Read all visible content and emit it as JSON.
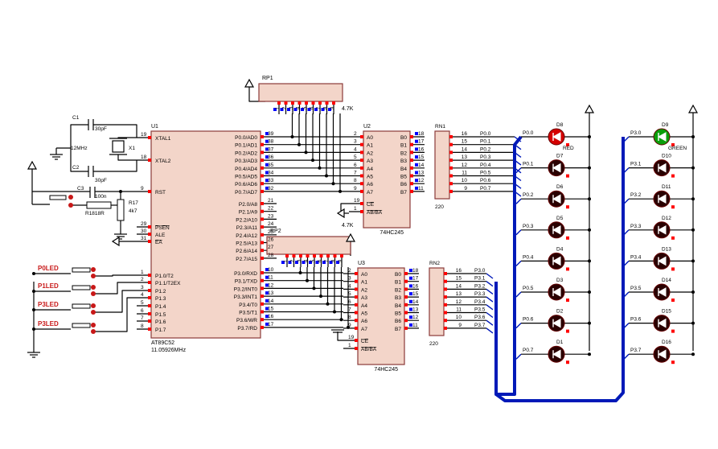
{
  "colors": {
    "wire": "#000000",
    "chip_fill": "#f3d5c9",
    "chip_stroke": "#8b3a3a",
    "pin_marker": "#ff0000",
    "pin_blue": "#0000ff",
    "bus": "#0019b8",
    "led_red": "#d40000",
    "led_green": "#0a9e0a",
    "led_dark": "#2a0000",
    "label_red": "#c81818"
  },
  "u1": {
    "ref": "U1",
    "part": "AT89C52",
    "freq": "11.05926MHz",
    "left_pins": [
      {
        "num": "19",
        "name": "XTAL1"
      },
      {
        "num": "18",
        "name": "XTAL2"
      },
      {
        "num": "9",
        "name": "RST"
      },
      {
        "num": "29",
        "name": "PSEN"
      },
      {
        "num": "30",
        "name": "ALE"
      },
      {
        "num": "31",
        "name": "EA"
      },
      {
        "num": "1",
        "name": "P1.0/T2"
      },
      {
        "num": "2",
        "name": "P1.1/T2EX"
      },
      {
        "num": "3",
        "name": "P1.2"
      },
      {
        "num": "4",
        "name": "P1.3"
      },
      {
        "num": "5",
        "name": "P1.4"
      },
      {
        "num": "6",
        "name": "P1.5"
      },
      {
        "num": "7",
        "name": "P1.6"
      },
      {
        "num": "8",
        "name": "P1.7"
      }
    ],
    "right_pins_p0": [
      {
        "num": "39",
        "name": "P0.0/AD0"
      },
      {
        "num": "38",
        "name": "P0.1/AD1"
      },
      {
        "num": "37",
        "name": "P0.2/AD2"
      },
      {
        "num": "36",
        "name": "P0.3/AD3"
      },
      {
        "num": "35",
        "name": "P0.4/AD4"
      },
      {
        "num": "34",
        "name": "P0.5/AD5"
      },
      {
        "num": "33",
        "name": "P0.6/AD6"
      },
      {
        "num": "32",
        "name": "P0.7/AD7"
      }
    ],
    "right_pins_p2": [
      {
        "num": "21",
        "name": "P2.0/A8"
      },
      {
        "num": "22",
        "name": "P2.1/A9"
      },
      {
        "num": "23",
        "name": "P2.2/A10"
      },
      {
        "num": "24",
        "name": "P2.3/A11"
      },
      {
        "num": "25",
        "name": "P2.4/A12"
      },
      {
        "num": "26",
        "name": "P2.5/A13"
      },
      {
        "num": "27",
        "name": "P2.6/A14"
      },
      {
        "num": "28",
        "name": "P2.7/A15"
      }
    ],
    "right_pins_p3": [
      {
        "num": "10",
        "name": "P3.0/RXD"
      },
      {
        "num": "11",
        "name": "P3.1/TXD"
      },
      {
        "num": "12",
        "name": "P3.2/INT0"
      },
      {
        "num": "13",
        "name": "P3.3/INT1"
      },
      {
        "num": "14",
        "name": "P3.4/T0"
      },
      {
        "num": "15",
        "name": "P3.5/T1"
      },
      {
        "num": "16",
        "name": "P3.6/WR"
      },
      {
        "num": "17",
        "name": "P3.7/RD"
      }
    ]
  },
  "u2": {
    "ref": "U2",
    "part": "74HC245",
    "a_pins": [
      "2",
      "3",
      "4",
      "5",
      "6",
      "7",
      "8",
      "9"
    ],
    "b_pins": [
      "18",
      "17",
      "16",
      "15",
      "14",
      "13",
      "12",
      "11"
    ],
    "a_names": [
      "A0",
      "A1",
      "A2",
      "A3",
      "A4",
      "A5",
      "A6",
      "A7"
    ],
    "b_names": [
      "B0",
      "B1",
      "B2",
      "B3",
      "B4",
      "B5",
      "B6",
      "B7"
    ],
    "ce_pin": "19",
    "ce_name": "CE",
    "dir_pin": "1",
    "dir_name": "AB/BA"
  },
  "u3": {
    "ref": "U3",
    "part": "74HC245",
    "a_pins": [
      "2",
      "3",
      "4",
      "5",
      "6",
      "7",
      "8",
      "9"
    ],
    "b_pins": [
      "18",
      "17",
      "16",
      "15",
      "14",
      "13",
      "12",
      "11"
    ],
    "a_names": [
      "A0",
      "A1",
      "A2",
      "A3",
      "A4",
      "A5",
      "A6",
      "A7"
    ],
    "b_names": [
      "B0",
      "B1",
      "B2",
      "B3",
      "B4",
      "B5",
      "B6",
      "B7"
    ],
    "ce_pin": "19",
    "ce_name": "CE",
    "dir_pin": "1",
    "dir_name": "AB/BA"
  },
  "rp1": {
    "ref": "RP1",
    "value": "4.7K",
    "pins": [
      "1",
      "2",
      "3",
      "4",
      "5",
      "6",
      "7",
      "8",
      "9"
    ]
  },
  "rp2": {
    "ref": "RP2",
    "value": "4.7K",
    "pins": [
      "1",
      "2",
      "3",
      "4",
      "5",
      "6",
      "7",
      "8",
      "9"
    ]
  },
  "rn1": {
    "ref": "RN1",
    "value": "220",
    "left_pins": [
      "1",
      "2",
      "3",
      "4",
      "5",
      "6",
      "7",
      "8"
    ],
    "right_pins": [
      "16",
      "15",
      "14",
      "13",
      "12",
      "11",
      "10",
      "9"
    ],
    "nets": [
      "P0.0",
      "P0.1",
      "P0.2",
      "P0.3",
      "P0.4",
      "P0.5",
      "P0.6",
      "P0.7"
    ]
  },
  "rn2": {
    "ref": "RN2",
    "value": "220",
    "left_pins": [
      "1",
      "2",
      "3",
      "4",
      "5",
      "6",
      "7",
      "8"
    ],
    "right_pins": [
      "16",
      "15",
      "14",
      "13",
      "12",
      "11",
      "10",
      "9"
    ],
    "nets": [
      "P3.0",
      "P3.1",
      "P3.2",
      "P3.3",
      "P3.4",
      "P3.5",
      "P3.6",
      "P3.7"
    ]
  },
  "crystal": {
    "ref": "X1",
    "freq": "12MHz"
  },
  "caps": {
    "c1": {
      "ref": "C1",
      "value": "30pF"
    },
    "c2": {
      "ref": "C2",
      "value": "30pF"
    },
    "c3": {
      "ref": "C3",
      "value": "100n"
    }
  },
  "resistors": {
    "r18": {
      "value": "R1818R"
    },
    "r17": {
      "ref": "R17",
      "value": "4k7"
    }
  },
  "p0_leds": [
    {
      "ref": "D8",
      "net": "P0.0",
      "color": "RED"
    },
    {
      "ref": "D7",
      "net": "P0.1"
    },
    {
      "ref": "D6",
      "net": "P0.2"
    },
    {
      "ref": "D5",
      "net": "P0.3"
    },
    {
      "ref": "D4",
      "net": "P0.4"
    },
    {
      "ref": "D3",
      "net": "P0.5"
    },
    {
      "ref": "D2",
      "net": "P0.6"
    },
    {
      "ref": "D1",
      "net": "P0.7"
    }
  ],
  "p3_leds": [
    {
      "ref": "D9",
      "net": "P3.0",
      "color": "GREEN"
    },
    {
      "ref": "D10",
      "net": "P3.1"
    },
    {
      "ref": "D11",
      "net": "P3.2"
    },
    {
      "ref": "D12",
      "net": "P3.3"
    },
    {
      "ref": "D13",
      "net": "P3.4"
    },
    {
      "ref": "D14",
      "net": "P3.5"
    },
    {
      "ref": "D15",
      "net": "P3.6"
    },
    {
      "ref": "D16",
      "net": "P3.7"
    }
  ],
  "buttons": [
    "P0LED",
    "P1LED",
    "P3LED",
    "P3LED"
  ]
}
